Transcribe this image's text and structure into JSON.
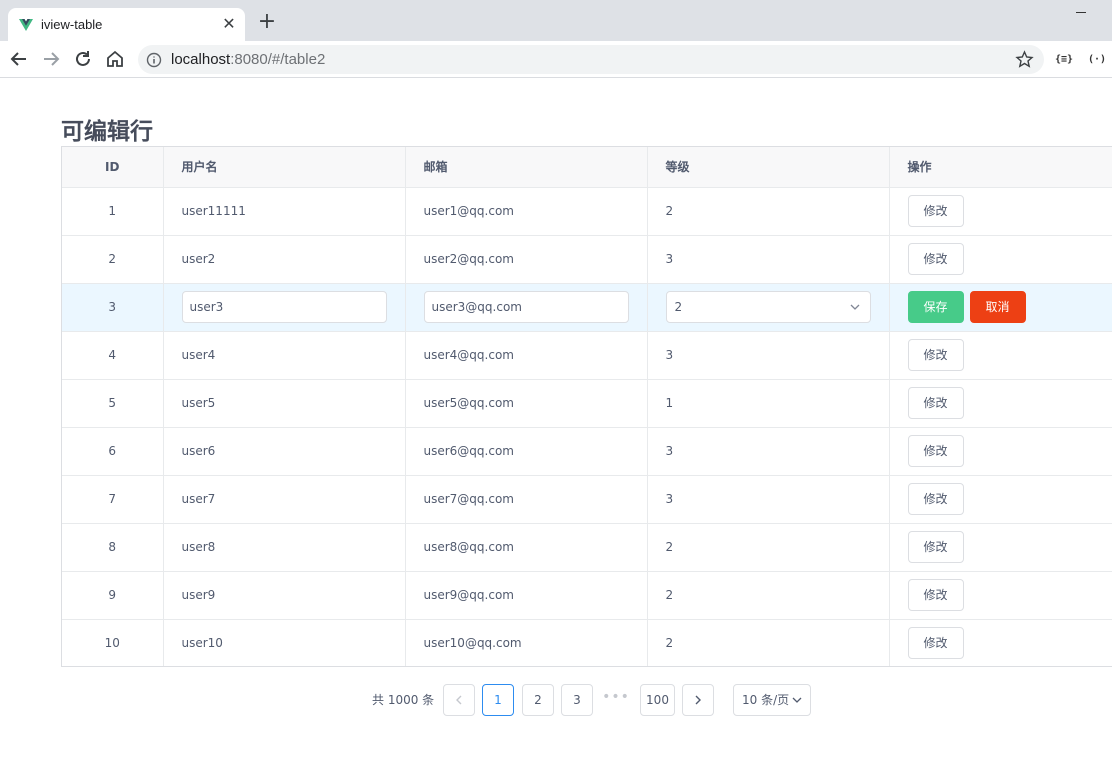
{
  "browser": {
    "tab_title": "iview-table",
    "tab_close": "✕",
    "new_tab": "+",
    "url_host": "localhost",
    "url_rest": ":8080/#/table2",
    "ext1": "{≡}",
    "ext2": "(·)"
  },
  "page": {
    "title": "可编辑行"
  },
  "table": {
    "headers": {
      "id": "ID",
      "username": "用户名",
      "email": "邮箱",
      "level": "等级",
      "actions": "操作"
    },
    "edit_label": "修改",
    "save_label": "保存",
    "cancel_label": "取消",
    "rows": [
      {
        "id": "1",
        "username": "user11111",
        "email": "user1@qq.com",
        "level": "2"
      },
      {
        "id": "2",
        "username": "user2",
        "email": "user2@qq.com",
        "level": "3"
      },
      {
        "id": "3",
        "username": "user3",
        "email": "user3@qq.com",
        "level": "2",
        "editing": true
      },
      {
        "id": "4",
        "username": "user4",
        "email": "user4@qq.com",
        "level": "3"
      },
      {
        "id": "5",
        "username": "user5",
        "email": "user5@qq.com",
        "level": "1"
      },
      {
        "id": "6",
        "username": "user6",
        "email": "user6@qq.com",
        "level": "3"
      },
      {
        "id": "7",
        "username": "user7",
        "email": "user7@qq.com",
        "level": "3"
      },
      {
        "id": "8",
        "username": "user8",
        "email": "user8@qq.com",
        "level": "2"
      },
      {
        "id": "9",
        "username": "user9",
        "email": "user9@qq.com",
        "level": "2"
      },
      {
        "id": "10",
        "username": "user10",
        "email": "user10@qq.com",
        "level": "2"
      }
    ]
  },
  "pagination": {
    "total_text": "共 1000 条",
    "pages": [
      "1",
      "2",
      "3"
    ],
    "active_page": "1",
    "ellipsis": "•••",
    "last_page": "100",
    "page_size": "10 条/页"
  },
  "colors": {
    "primary": "#2d8cf0",
    "success": "#47cb89",
    "error": "#ed4014",
    "row_highlight": "#ebf7ff"
  }
}
